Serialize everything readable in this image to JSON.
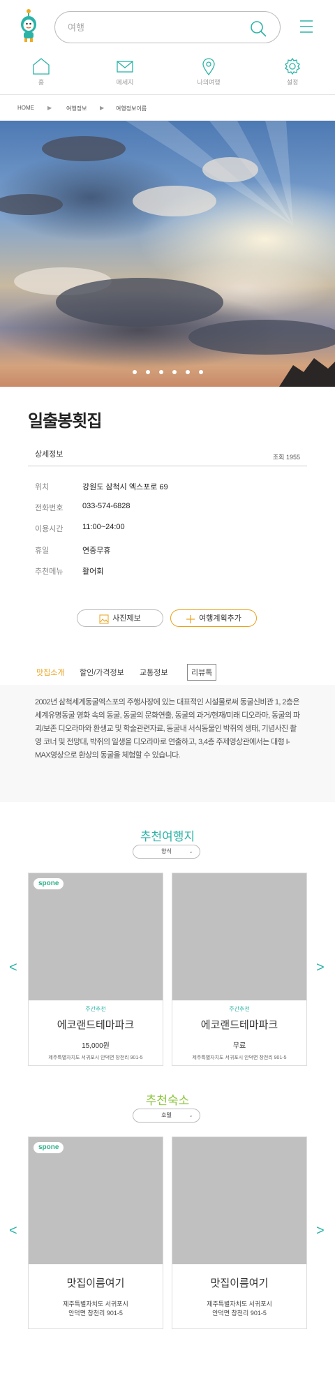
{
  "header": {
    "search_placeholder": "여행",
    "nav": [
      {
        "label": "홈",
        "icon": "home-icon"
      },
      {
        "label": "메세지",
        "icon": "mail-icon"
      },
      {
        "label": "나의여행",
        "icon": "location-pin-icon"
      },
      {
        "label": "설정",
        "icon": "gear-icon"
      }
    ]
  },
  "breadcrumb": [
    "HOME",
    "여행정보",
    "여행정보이름"
  ],
  "hero": {
    "slide_count": 6
  },
  "place": {
    "title": "일출봉횟집",
    "section_label": "상세정보",
    "views": "조회 1955",
    "info": [
      {
        "key": "위치",
        "value": "강원도 삼척시 엑스포로 69"
      },
      {
        "key": "전화번호",
        "value": "033-574-6828"
      },
      {
        "key": "이용시간",
        "value": "11:00~24:00"
      },
      {
        "key": "휴일",
        "value": "연중무휴"
      },
      {
        "key": "추천메뉴",
        "value": "활어회"
      }
    ],
    "buttons": {
      "photo": "사진제보",
      "plan": "여행계획추가"
    }
  },
  "tabs": [
    "맛집소개",
    "할인/가격정보",
    "교통정보",
    "리뷰톡"
  ],
  "description": "2002년 삼척세계동굴엑스포의 주행사장에 있는 대표적인 시설물로써 동굴신비관 1, 2층은 세계유명동굴 영화 속의 동굴, 동굴의 문화연출, 동굴의 과거/현재/미래 디오라마, 동굴의 파괴/보존 디오라마와 환생교 및 학술관련자료, 동굴내 서식동물인 박쥐의 생태, 기념사진 촬영 코너 및 전망대, 박쥐의 일생을 디오라마로 연출하고, 3,4층 주제영상관에서는 대형 I-MAX영상으로 환상의 동굴을 체험할 수 있습니다.",
  "recommend_travel": {
    "title": "추천여행지",
    "filter": "양식",
    "cards": [
      {
        "badge": "spone",
        "tag": "주간추천",
        "name": "에코랜드테마파크",
        "price": "15,000원",
        "address": "제주특별자치도 서귀포시 안덕면 창천리 901-5"
      },
      {
        "tag": "주간추천",
        "name": "에코랜드테마파크",
        "price": "무료",
        "address": "제주특별자치도 서귀포시 안덕면 창천리 901-5"
      }
    ]
  },
  "recommend_stay": {
    "title": "추천숙소",
    "filter": "호텔",
    "cards": [
      {
        "badge": "spone",
        "name": "맛집이름여기",
        "address_line1": "제주특별자치도 서귀포시",
        "address_line2": "안덕면 창천리 901-5"
      },
      {
        "name": "맛집이름여기",
        "address_line1": "제주특별자치도 서귀포시",
        "address_line2": "안덕면 창천리 901-5"
      }
    ]
  },
  "arrows": {
    "prev": "<",
    "next": ">"
  },
  "colors": {
    "accent": "#2bb3a7",
    "highlight": "#e8a31d",
    "stay_title": "#8cc63f"
  }
}
